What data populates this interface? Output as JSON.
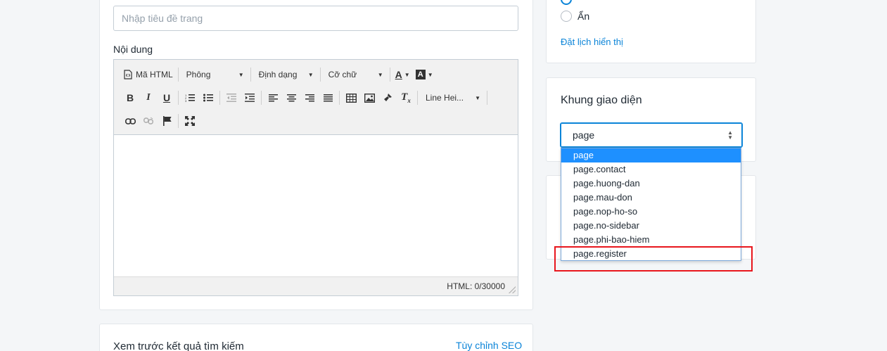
{
  "page_form": {
    "title_placeholder": "Nhập tiêu đề trang",
    "content_label": "Nội dung"
  },
  "editor": {
    "toolbar": {
      "html_label": "Mã HTML",
      "font_label": "Phông",
      "format_label": "Định dạng",
      "size_label": "Cỡ chữ",
      "line_height_label": "Line Hei..."
    },
    "status": "HTML: 0/30000"
  },
  "seo": {
    "title": "Xem trước kết quả tìm kiếm",
    "customize_link": "Tùy chỉnh SEO"
  },
  "visibility": {
    "hidden_label": "Ẩn",
    "schedule_link": "Đặt lịch hiển thị"
  },
  "template": {
    "title": "Khung giao diện",
    "selected": "page",
    "options": [
      "page",
      "page.contact",
      "page.huong-dan",
      "page.mau-don",
      "page.nop-ho-so",
      "page.no-sidebar",
      "page.phi-bao-hiem",
      "page.register"
    ]
  },
  "colors": {
    "accent": "#0b84d8",
    "selected_option": "#1e90ff",
    "highlight": "#e8161d"
  }
}
